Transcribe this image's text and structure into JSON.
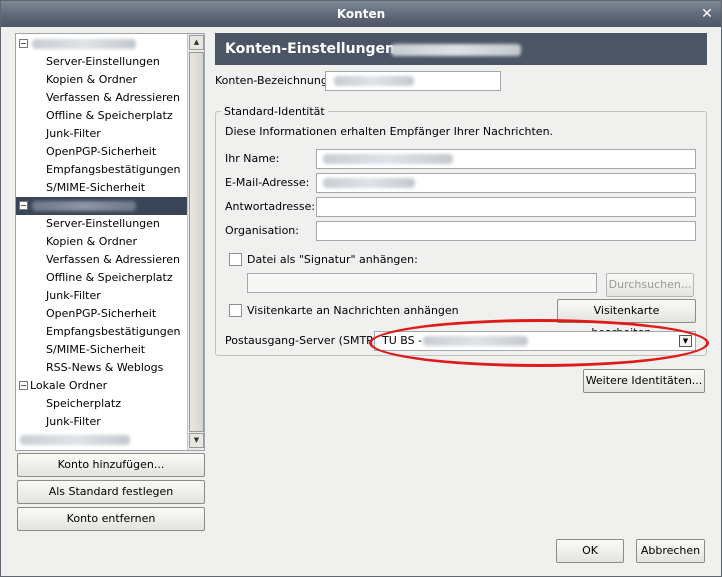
{
  "window": {
    "title": "Konten",
    "close_glyph": "✕"
  },
  "tree": {
    "rows": [
      {
        "label": "",
        "expanded": true,
        "blurred": true
      },
      {
        "label": "Server-Einstellungen"
      },
      {
        "label": "Kopien & Ordner"
      },
      {
        "label": "Verfassen & Adressieren"
      },
      {
        "label": "Offline & Speicherplatz"
      },
      {
        "label": "Junk-Filter"
      },
      {
        "label": "OpenPGP-Sicherheit"
      },
      {
        "label": "Empfangsbestätigungen"
      },
      {
        "label": "S/MIME-Sicherheit"
      },
      {
        "label": "",
        "expanded": true,
        "blurred": true,
        "selected": true
      },
      {
        "label": "Server-Einstellungen"
      },
      {
        "label": "Kopien & Ordner"
      },
      {
        "label": "Verfassen & Adressieren"
      },
      {
        "label": "Offline & Speicherplatz"
      },
      {
        "label": "Junk-Filter"
      },
      {
        "label": "OpenPGP-Sicherheit"
      },
      {
        "label": "Empfangsbestätigungen"
      },
      {
        "label": "S/MIME-Sicherheit"
      },
      {
        "label": "RSS-News & Weblogs"
      },
      {
        "label": "Lokale Ordner",
        "expanded": true
      },
      {
        "label": "Speicherplatz"
      },
      {
        "label": "Junk-Filter"
      },
      {
        "label": "",
        "blurred": true
      }
    ],
    "scroll_up_glyph": "▲",
    "scroll_down_glyph": "▼"
  },
  "left_buttons": {
    "add_account": "Konto hinzufügen...",
    "set_default": "Als Standard festlegen",
    "remove_account": "Konto entfernen"
  },
  "panel": {
    "header_title": "Konten-Einstellungen -",
    "account_name_label": "Konten-Bezeichnung:",
    "identity_legend": "Standard-Identität",
    "identity_info": "Diese Informationen erhalten Empfänger Ihrer Nachrichten.",
    "name_label": "Ihr Name:",
    "email_label": "E-Mail-Adresse:",
    "reply_label": "Antwortadresse:",
    "org_label": "Organisation:",
    "signature_label": "Datei als \"Signatur\" anhängen:",
    "browse_button": "Durchsuchen...",
    "vcard_label": "Visitenkarte an Nachrichten anhängen",
    "vcard_edit_button": "Visitenkarte bearbeiten...",
    "smtp_label": "Postausgang-Server (SMTP):",
    "smtp_value": "TU BS -",
    "smtp_arrow": "▼",
    "more_identities_button": "Weitere Identitäten..."
  },
  "footer": {
    "ok": "OK",
    "cancel": "Abbrechen"
  },
  "colors": {
    "header_bg": "#4b5565",
    "selected_row_bg": "#3a4657",
    "annotation_red": "#e01919"
  }
}
